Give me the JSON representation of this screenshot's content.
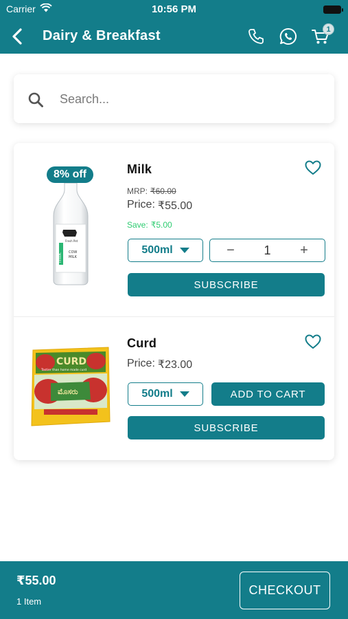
{
  "status_bar": {
    "carrier": "Carrier",
    "time": "10:56 PM"
  },
  "header": {
    "title": "Dairy & Breakfast",
    "cart_count": "1",
    "icons": [
      "back-arrow-icon",
      "phone-icon",
      "whatsapp-icon",
      "cart-icon"
    ]
  },
  "search": {
    "placeholder": "Search..."
  },
  "products": [
    {
      "name": "Milk",
      "discount": "8% off",
      "mrp_label": "MRP:",
      "mrp": "₹60.00",
      "price_label": "Price:",
      "price": "₹55.00",
      "save_label": "Save:",
      "save": "₹5.00",
      "size": "500ml",
      "quantity": "1",
      "primary_action": "SUBSCRIBE",
      "image_text": [
        "Fresh Pet",
        "COW",
        "MILK",
        "milk"
      ]
    },
    {
      "name": "Curd",
      "price_label": "Price:",
      "price": "₹23.00",
      "size": "500ml",
      "cart_action": "ADD TO CART",
      "primary_action": "SUBSCRIBE",
      "image_text": [
        "CURD",
        "Tastier than home made curd",
        "ಮೊಸರು"
      ]
    }
  ],
  "footer": {
    "total": "₹55.00",
    "items": "1 Item",
    "checkout": "CHECKOUT"
  },
  "colors": {
    "primary": "#137d8a",
    "save_green": "#2ecc71",
    "badge_bg": "#d7e4e6"
  }
}
